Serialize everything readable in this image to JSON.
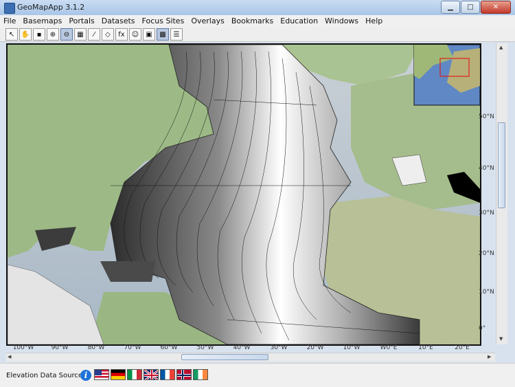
{
  "window": {
    "title": "GeoMapApp 3.1.2"
  },
  "menubar": {
    "items": [
      "File",
      "Basemaps",
      "Portals",
      "Datasets",
      "Focus Sites",
      "Overlays",
      "Bookmarks",
      "Education",
      "Windows",
      "Help"
    ]
  },
  "toolbar": {
    "tools": [
      {
        "name": "select-arrow-icon",
        "glyph": "↖",
        "active": false
      },
      {
        "name": "pan-hand-icon",
        "glyph": "✋",
        "active": false
      },
      {
        "name": "save-disk-icon",
        "glyph": "▪",
        "active": false
      },
      {
        "name": "zoom-in-icon",
        "glyph": "⊕",
        "active": false
      },
      {
        "name": "zoom-out-icon",
        "glyph": "⊖",
        "active": true
      },
      {
        "name": "graticule-icon",
        "glyph": "▦",
        "active": false
      },
      {
        "name": "profile-icon",
        "glyph": "⁄",
        "active": false
      },
      {
        "name": "polygon-icon",
        "glyph": "◇",
        "active": false
      },
      {
        "name": "function-icon",
        "glyph": "fx",
        "active": false
      },
      {
        "name": "face-icon",
        "glyph": "☺",
        "active": false
      },
      {
        "name": "image-icon",
        "glyph": "▣",
        "active": false
      },
      {
        "name": "grid-icon",
        "glyph": "▩",
        "active": true
      },
      {
        "name": "list-icon",
        "glyph": "☰",
        "active": false
      }
    ]
  },
  "map": {
    "lat_labels": [
      "50°N",
      "40°N",
      "30°N",
      "20°N",
      "10°N",
      "0°"
    ],
    "lon_labels": [
      "100°W",
      "90°W",
      "80°W",
      "70°W",
      "60°W",
      "50°W",
      "40°W",
      "30°W",
      "20°W",
      "10°W",
      "W0°E",
      "10°E",
      "20°E"
    ],
    "colors": {
      "land": "#9fb98a",
      "ocean": "#7f9fc0",
      "shade_dark": "#3a3a3a",
      "shade_light": "#ffffff",
      "inset_box": "#e02020"
    }
  },
  "status": {
    "label": "Elevation Data Sources",
    "info_glyph": "i",
    "flags": [
      "usa-flag",
      "germany-flag",
      "italy-flag",
      "uk-flag",
      "france-flag",
      "norway-flag",
      "ireland-flag"
    ]
  }
}
